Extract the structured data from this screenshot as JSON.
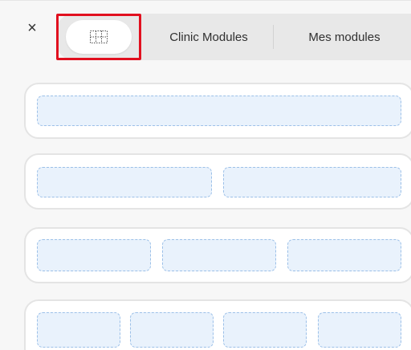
{
  "header": {
    "close_label": "×",
    "tabs": [
      {
        "icon": "grid-layout-icon"
      },
      {
        "label": "Clinic Modules"
      },
      {
        "label": "Mes modules"
      }
    ]
  },
  "layouts": [
    {
      "columns": 1
    },
    {
      "columns": 2
    },
    {
      "columns": 3
    },
    {
      "columns": 4
    }
  ],
  "colors": {
    "highlight": "#e1101f",
    "slot_fill": "#e9f2fc",
    "slot_border": "#9cc0e8"
  }
}
